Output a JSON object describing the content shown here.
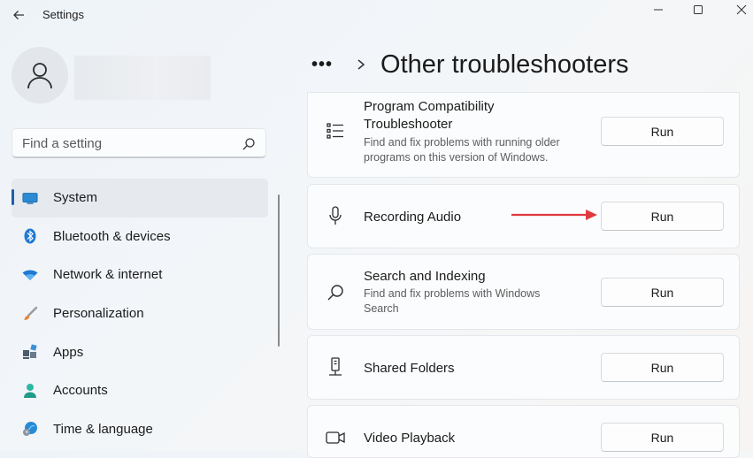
{
  "window": {
    "title": "Settings"
  },
  "search": {
    "placeholder": "Find a setting"
  },
  "sidebar": {
    "items": [
      {
        "label": "System",
        "icon": "monitor-icon",
        "selected": true
      },
      {
        "label": "Bluetooth & devices",
        "icon": "bluetooth-icon"
      },
      {
        "label": "Network & internet",
        "icon": "wifi-icon"
      },
      {
        "label": "Personalization",
        "icon": "brush-icon"
      },
      {
        "label": "Apps",
        "icon": "apps-icon"
      },
      {
        "label": "Accounts",
        "icon": "person-icon"
      },
      {
        "label": "Time & language",
        "icon": "globe-clock-icon"
      }
    ]
  },
  "breadcrumb": {
    "more": "•••",
    "title": "Other troubleshooters"
  },
  "troubleshooters": [
    {
      "title": "Program Compatibility Troubleshooter",
      "desc": "Find and fix problems with running older programs on this version of Windows.",
      "run": "Run",
      "icon": "list-icon"
    },
    {
      "title": "Recording Audio",
      "desc": "",
      "run": "Run",
      "icon": "microphone-icon"
    },
    {
      "title": "Search and Indexing",
      "desc": "Find and fix problems with Windows Search",
      "run": "Run",
      "icon": "search-icon"
    },
    {
      "title": "Shared Folders",
      "desc": "",
      "run": "Run",
      "icon": "shared-folder-icon"
    },
    {
      "title": "Video Playback",
      "desc": "",
      "run": "Run",
      "icon": "video-camera-icon"
    }
  ],
  "colors": {
    "accent": "#1f5fa8",
    "annotation_arrow": "#e0393e"
  }
}
